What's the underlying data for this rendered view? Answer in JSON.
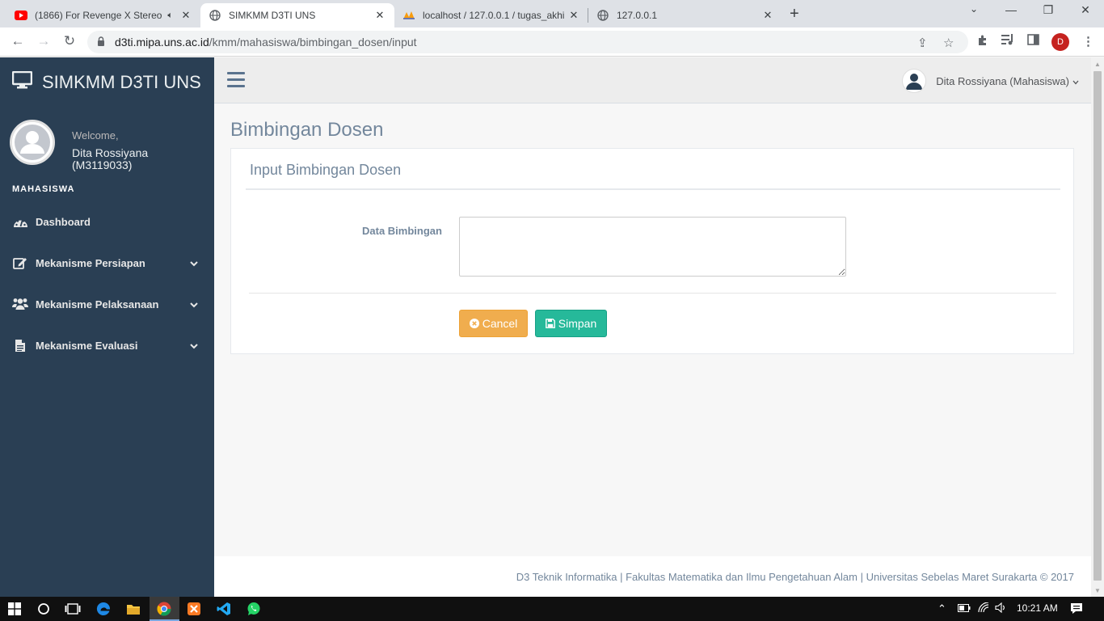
{
  "browser": {
    "tabs": [
      {
        "title": "(1866) For Revenge X Stereo",
        "icon": "youtube-icon",
        "active": false
      },
      {
        "title": "SIMKMM D3TI UNS",
        "icon": "globe-icon",
        "active": true
      },
      {
        "title": "localhost / 127.0.0.1 / tugas_akhi",
        "icon": "phpmyadmin-icon",
        "active": false
      },
      {
        "title": "127.0.0.1",
        "icon": "globe-icon",
        "active": false
      }
    ],
    "url_host": "d3ti.mipa.uns.ac.id",
    "url_path": "/kmm/mahasiswa/bimbingan_dosen/input",
    "profile_initial": "D"
  },
  "sidebar": {
    "brand": "SIMKMM D3TI UNS",
    "welcome": "Welcome,",
    "user_name": "Dita Rossiyana (M3119033)",
    "section": "MAHASISWA",
    "items": [
      {
        "label": "Dashboard",
        "icon": "dashboard-icon",
        "has_submenu": false
      },
      {
        "label": "Mekanisme Persiapan",
        "icon": "edit-icon",
        "has_submenu": true
      },
      {
        "label": "Mekanisme Pelaksanaan",
        "icon": "users-icon",
        "has_submenu": true
      },
      {
        "label": "Mekanisme Evaluasi",
        "icon": "document-icon",
        "has_submenu": true
      }
    ]
  },
  "topnav": {
    "user_label": "Dita Rossiyana (Mahasiswa)"
  },
  "main": {
    "page_title": "Bimbingan Dosen",
    "panel_title": "Input Bimbingan Dosen",
    "form": {
      "field_label": "Data Bimbingan",
      "field_value": "",
      "cancel_label": "Cancel",
      "save_label": "Simpan"
    }
  },
  "footer": {
    "text": "D3 Teknik Informatika | Fakultas Matematika dan Ilmu Pengetahuan Alam | Universitas Sebelas Maret Surakarta © 2017"
  },
  "taskbar": {
    "clock": "10:21 AM"
  },
  "colors": {
    "sidebar_bg": "#2a3f54",
    "accent_title": "#73879c",
    "cancel_btn": "#f0ad4e",
    "save_btn": "#26b99a"
  }
}
